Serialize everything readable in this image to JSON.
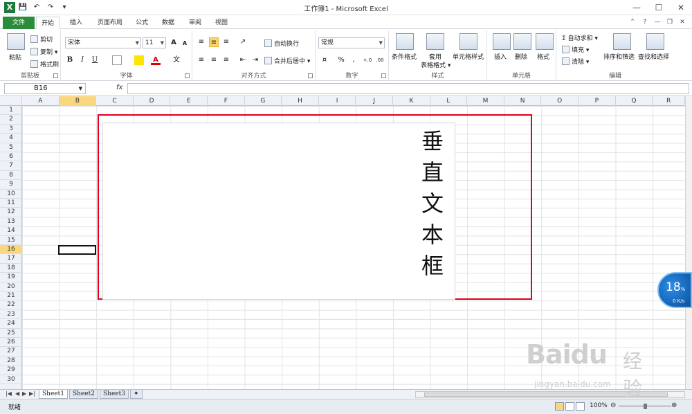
{
  "window": {
    "title": "工作簿1 - Microsoft Excel",
    "app_icon": "X",
    "controls": [
      "—",
      "☐",
      "✕"
    ]
  },
  "qat": {
    "save": "💾",
    "undo": "↶",
    "redo": "↷",
    "customize": "▾"
  },
  "tabs": [
    "文件",
    "开始",
    "插入",
    "页面布局",
    "公式",
    "数据",
    "审阅",
    "视图"
  ],
  "tab_controls": [
    "⌃",
    "?",
    "—",
    "❐",
    "✕"
  ],
  "ribbon": {
    "clipboard": {
      "label": "剪贴板",
      "paste": "粘贴",
      "cut": "剪切",
      "copy": "复制 ▾",
      "format_painter": "格式刷"
    },
    "font": {
      "label": "字体",
      "font_name": "宋体",
      "font_size": "11",
      "grow": "A",
      "shrink": "A",
      "bold": "B",
      "italic": "I",
      "underline": "U",
      "phonetic": "文"
    },
    "alignment": {
      "label": "对齐方式",
      "wrap_text": "自动换行",
      "merge_center": "合并后居中 ▾"
    },
    "number": {
      "label": "数字",
      "format": "常规",
      "percent": "%",
      "comma": ",",
      "inc_decimal": "+.0",
      "dec_decimal": ".00"
    },
    "styles": {
      "label": "样式",
      "conditional": "条件格式",
      "table_style": "套用",
      "table_style2": "表格格式 ▾",
      "cell_style": "单元格样式"
    },
    "cells": {
      "label": "单元格",
      "insert": "插入",
      "delete": "删除",
      "format": "格式"
    },
    "editing": {
      "label": "编辑",
      "autosum": "Σ 自动求和 ▾",
      "fill": "填充 ▾",
      "clear": "清除 ▾",
      "sort_filter": "排序和筛选",
      "find_select": "查找和选择"
    }
  },
  "formula_bar": {
    "name_box": "B16",
    "fx": "fx",
    "formula": ""
  },
  "grid": {
    "columns": [
      "A",
      "B",
      "C",
      "D",
      "E",
      "F",
      "G",
      "H",
      "I",
      "J",
      "K",
      "L",
      "M",
      "N",
      "O",
      "P",
      "Q",
      "R"
    ],
    "rows": [
      "1",
      "2",
      "3",
      "4",
      "5",
      "6",
      "7",
      "8",
      "9",
      "10",
      "11",
      "12",
      "13",
      "14",
      "15",
      "16",
      "17",
      "18",
      "19",
      "20",
      "21",
      "22",
      "23",
      "24",
      "25",
      "26",
      "27",
      "28",
      "29",
      "30"
    ],
    "selected_column": "B",
    "selected_row": "16"
  },
  "textbox": {
    "text_chars": [
      "垂",
      "直",
      "文",
      "本",
      "框"
    ]
  },
  "sheets": [
    "Sheet1",
    "Sheet2",
    "Sheet3"
  ],
  "active_sheet": "Sheet1",
  "status": {
    "ready": "就绪",
    "zoom": "100%"
  },
  "net_widget": {
    "percent": "18",
    "unit": "%",
    "speed": "0 K/s"
  },
  "watermark": {
    "logo": "Baidu",
    "cn": "经验",
    "url": "jingyan.baidu.com"
  }
}
